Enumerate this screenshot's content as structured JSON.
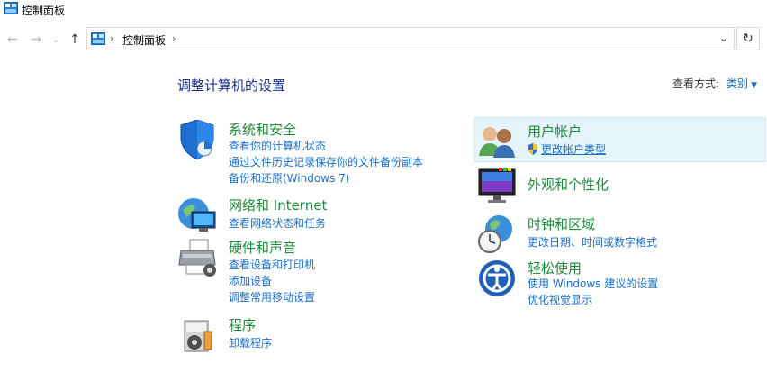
{
  "window": {
    "title": "控制面板"
  },
  "nav": {
    "back_glyph": "←",
    "forward_glyph": "→",
    "recent_glyph": "⌄",
    "up_glyph": "↑",
    "address_sep": "›",
    "address_crumb": "控制面板",
    "dropdown_glyph": "⌄",
    "refresh_glyph": "↻"
  },
  "main": {
    "heading": "调整计算机的设置",
    "view_by_label": "查看方式:",
    "view_by_value": "类别",
    "view_by_arrow": "▼"
  },
  "categories": {
    "system": {
      "title": "系统和安全",
      "links": [
        "查看你的计算机状态",
        "通过文件历史记录保存你的文件备份副本",
        "备份和还原(Windows 7)"
      ]
    },
    "network": {
      "title": "网络和 Internet",
      "links": [
        "查看网络状态和任务"
      ]
    },
    "hardware": {
      "title": "硬件和声音",
      "links": [
        "查看设备和打印机",
        "添加设备",
        "调整常用移动设置"
      ]
    },
    "programs": {
      "title": "程序",
      "links": [
        "卸载程序"
      ]
    },
    "user": {
      "title": "用户帐户",
      "links": [
        "更改帐户类型"
      ]
    },
    "appearance": {
      "title": "外观和个性化",
      "links": []
    },
    "clock": {
      "title": "时钟和区域",
      "links": [
        "更改日期、时间或数字格式"
      ]
    },
    "ease": {
      "title": "轻松使用",
      "links": [
        "使用 Windows 建议的设置",
        "优化视觉显示"
      ]
    }
  }
}
